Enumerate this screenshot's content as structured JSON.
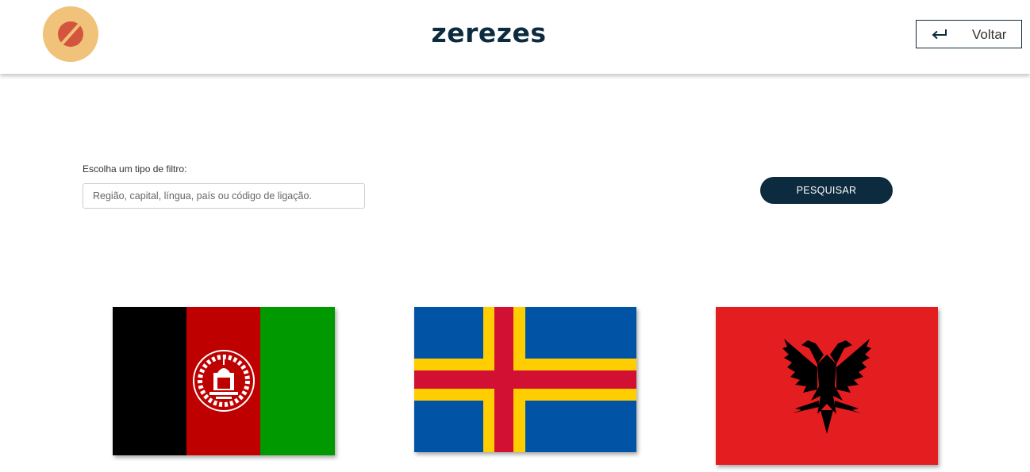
{
  "header": {
    "brand": "zerezes",
    "back_button": {
      "label": "Voltar",
      "icon": "arrow-left-icon"
    },
    "logo_icon": "logo-icon"
  },
  "filter": {
    "label": "Escolha um tipo de filtro:",
    "placeholder": "Região, capital, língua, país ou código de ligação.",
    "value": "",
    "search_button": "PESQUISAR"
  },
  "flags": [
    {
      "country": "Afghanistan",
      "colors": [
        "#000000",
        "#be0000",
        "#009900"
      ]
    },
    {
      "country": "Åland Islands",
      "colors": [
        "#0053a5",
        "#ffce00",
        "#d21034"
      ]
    },
    {
      "country": "Albania",
      "colors": [
        "#e41e20",
        "#000000"
      ]
    }
  ]
}
